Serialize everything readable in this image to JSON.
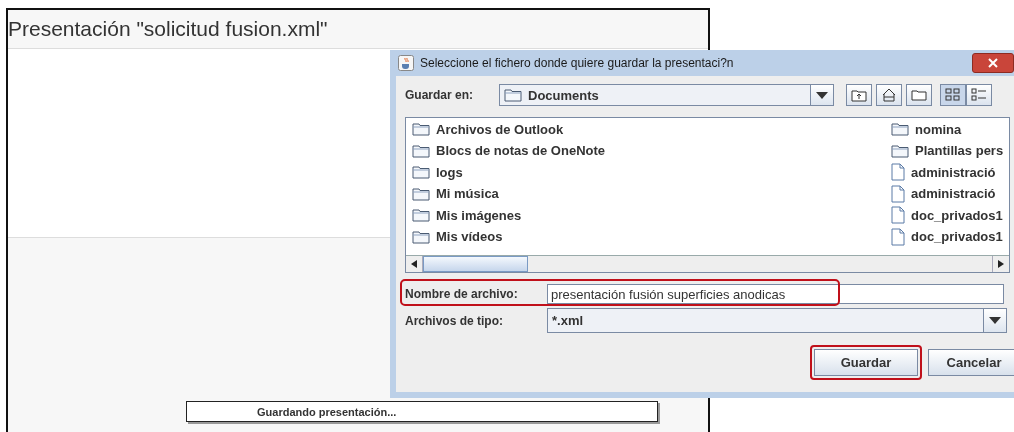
{
  "window": {
    "title": "Presentación \"solicitud fusion.xml\""
  },
  "dialog": {
    "title": "Seleccione el fichero donde quiere guardar la presentaci?n",
    "look_in": {
      "label": "Guardar en:",
      "value": "Documents"
    },
    "view_buttons": [
      {
        "kind": "list",
        "selected": true
      },
      {
        "kind": "details",
        "selected": false
      }
    ],
    "file_columns": [
      {
        "items": [
          {
            "kind": "folder",
            "name": "Archivos de Outlook"
          },
          {
            "kind": "folder",
            "name": "Blocs de notas de OneNote"
          },
          {
            "kind": "folder",
            "name": "logs"
          },
          {
            "kind": "folder",
            "name": "Mi música"
          },
          {
            "kind": "folder",
            "name": "Mis imágenes"
          },
          {
            "kind": "folder",
            "name": "Mis vídeos"
          }
        ]
      },
      {
        "items": [
          {
            "kind": "folder",
            "name": "nomina"
          },
          {
            "kind": "folder",
            "name": "Plantillas pers"
          },
          {
            "kind": "file",
            "name": "administració"
          },
          {
            "kind": "file",
            "name": "administració"
          },
          {
            "kind": "file",
            "name": "doc_privados1"
          },
          {
            "kind": "file",
            "name": "doc_privados1"
          }
        ]
      }
    ],
    "file_name": {
      "label": "Nombre de archivo:",
      "value": "presentación fusión superficies anodicas",
      "highlighted": true
    },
    "file_type": {
      "label": "Archivos de tipo:",
      "value": "*.xml"
    },
    "buttons": [
      {
        "label": "Guardar",
        "highlighted": true
      },
      {
        "label": "Cancelar",
        "highlighted": false
      }
    ]
  },
  "progress": {
    "label": "Guardando presentación..."
  }
}
